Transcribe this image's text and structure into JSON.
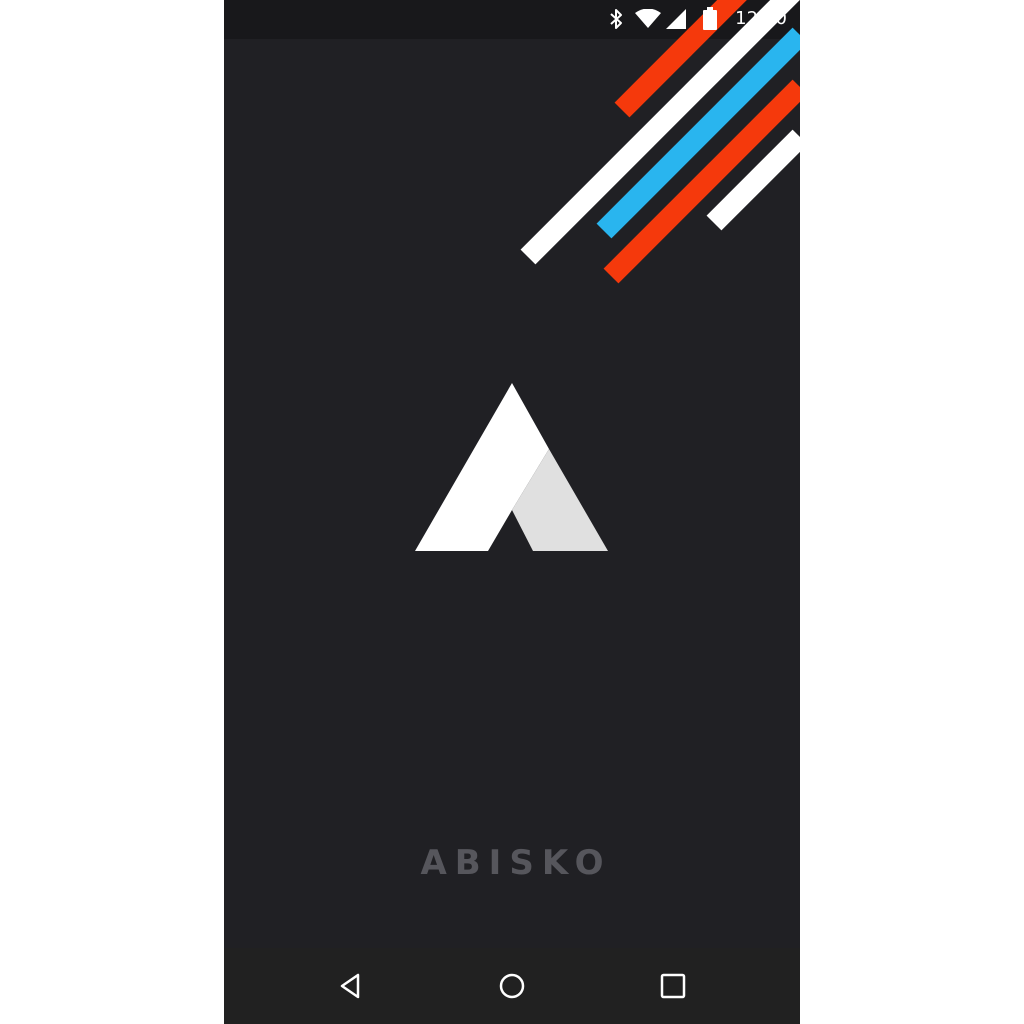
{
  "app": {
    "name": "ABISKO"
  },
  "status_bar": {
    "time": "12:30",
    "icons": [
      "bluetooth-icon",
      "wifi-icon",
      "cell-signal-icon",
      "battery-icon"
    ]
  },
  "navigation_bar": {
    "buttons": [
      "back-button",
      "home-button",
      "recents-button"
    ]
  },
  "colors": {
    "background": "#202024",
    "status_bar": "#18181b",
    "nav_bar": "#212121",
    "stripe_orange": "#f5390c",
    "stripe_blue": "#29b5ef",
    "stripe_white": "#ffffff",
    "logo_primary": "#ffffff",
    "logo_secondary": "#e0e0e0",
    "brand_text": "#56565c"
  }
}
